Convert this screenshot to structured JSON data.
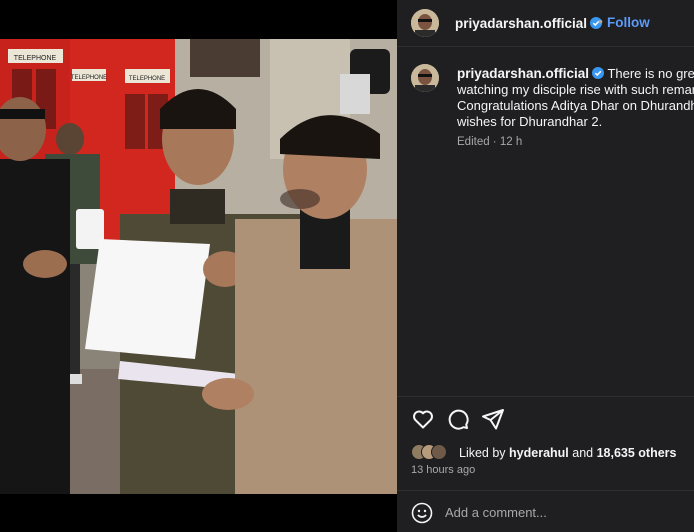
{
  "post": {
    "image_alt": "Film set photo of men reviewing script pages in a street with red phone boxes",
    "phone_box_labels": [
      "TELEPHONE",
      "TELEPHONE",
      "TELEPHONE"
    ]
  },
  "header": {
    "username": "priyadarshan.official",
    "separator": "•",
    "follow_label": "Follow",
    "verified_icon": "verified-badge-icon"
  },
  "caption": {
    "username": "priyadarshan.official",
    "lines": [
      "There is no greate",
      "watching my disciple rise with such remar",
      "Congratulations Aditya Dhar on Dhurandh",
      "wishes for Dhurandhar 2."
    ],
    "meta": "Edited · 12 h"
  },
  "actions": {
    "like_icon": "heart-icon",
    "comment_icon": "comment-icon",
    "share_icon": "send-icon"
  },
  "likes": {
    "prefix": "Liked by ",
    "user": "hyderahul",
    "middle": " and ",
    "others": "18,635 others"
  },
  "time_ago": "13 hours ago",
  "comment": {
    "placeholder": "Add a comment..."
  },
  "colors": {
    "panel_bg": "#1f1f21",
    "accent": "#5b9bf9",
    "verified": "#3897f0",
    "muted": "#a8a8a8"
  }
}
